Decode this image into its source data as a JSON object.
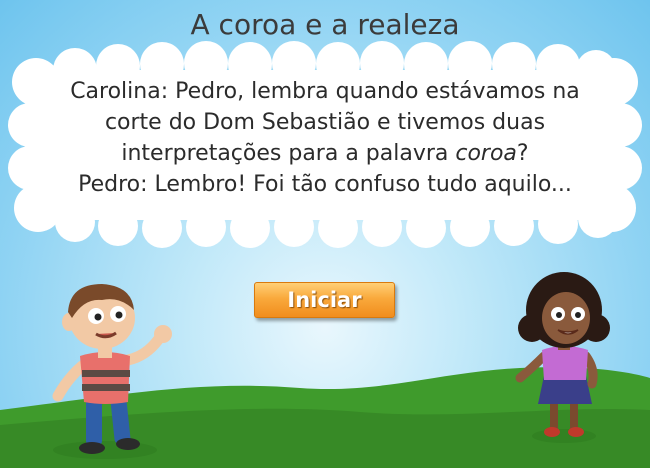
{
  "page": {
    "title": "A coroa e a realeza"
  },
  "dialogue": {
    "line1": "Carolina: Pedro, lembra quando estávamos na",
    "line2": "corte do Dom Sebastião e tivemos duas",
    "line3_prefix": "interpretações para a palavra ",
    "line3_emphasis": "coroa",
    "line3_suffix": "?",
    "line4": "Pedro: Lembro! Foi tão confuso tudo aquilo..."
  },
  "start_button": {
    "label": "Iniciar"
  },
  "characters": {
    "left": "boy-character",
    "right": "girl-character"
  },
  "colors": {
    "sky": "#8fd3f3",
    "grass": "#3f9b2c",
    "button": "#f9a93c",
    "button_text": "#ffffff"
  }
}
